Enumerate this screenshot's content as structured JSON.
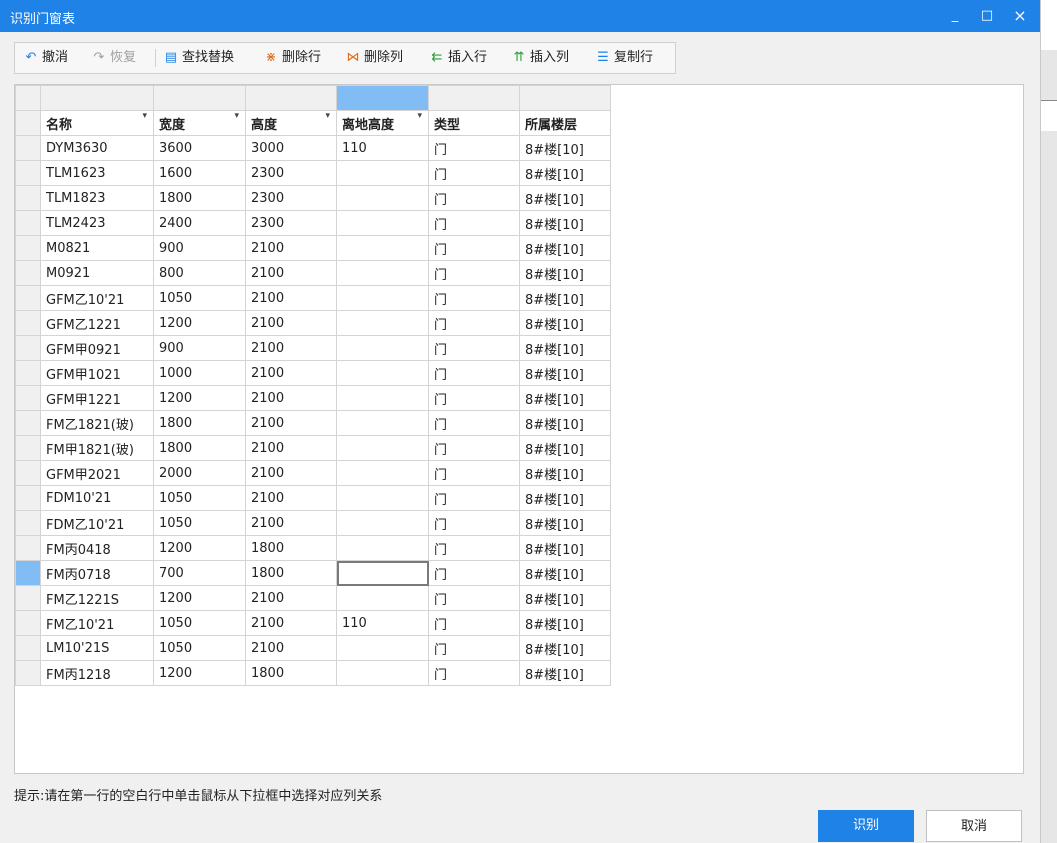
{
  "window": {
    "title": "识别门窗表",
    "minimize": "_",
    "maximize": "□",
    "close": "×"
  },
  "toolbar": {
    "undo": "撤消",
    "redo": "恢复",
    "find_replace": "查找替换",
    "delete_row": "删除行",
    "delete_col": "删除列",
    "insert_row": "插入行",
    "insert_col": "插入列",
    "copy_row": "复制行"
  },
  "grid": {
    "columns": [
      "名称",
      "宽度",
      "高度",
      "离地高度",
      "类型",
      "所属楼层"
    ],
    "dropdown_marker": "▾",
    "rows": [
      [
        "DYM3630",
        "3600",
        "3000",
        "110",
        "门",
        "8#楼[10]"
      ],
      [
        "TLM1623",
        "1600",
        "2300",
        "",
        "门",
        "8#楼[10]"
      ],
      [
        "TLM1823",
        "1800",
        "2300",
        "",
        "门",
        "8#楼[10]"
      ],
      [
        "TLM2423",
        "2400",
        "2300",
        "",
        "门",
        "8#楼[10]"
      ],
      [
        "M0821",
        "900",
        "2100",
        "",
        "门",
        "8#楼[10]"
      ],
      [
        "M0921",
        "800",
        "2100",
        "",
        "门",
        "8#楼[10]"
      ],
      [
        "GFM乙10'21",
        "1050",
        "2100",
        "",
        "门",
        "8#楼[10]"
      ],
      [
        "GFM乙1221",
        "1200",
        "2100",
        "",
        "门",
        "8#楼[10]"
      ],
      [
        "GFM甲0921",
        "900",
        "2100",
        "",
        "门",
        "8#楼[10]"
      ],
      [
        "GFM甲1021",
        "1000",
        "2100",
        "",
        "门",
        "8#楼[10]"
      ],
      [
        "GFM甲1221",
        "1200",
        "2100",
        "",
        "门",
        "8#楼[10]"
      ],
      [
        "FM乙1821(玻)",
        "1800",
        "2100",
        "",
        "门",
        "8#楼[10]"
      ],
      [
        "FM甲1821(玻)",
        "1800",
        "2100",
        "",
        "门",
        "8#楼[10]"
      ],
      [
        "GFM甲2021",
        "2000",
        "2100",
        "",
        "门",
        "8#楼[10]"
      ],
      [
        "FDM10'21",
        "1050",
        "2100",
        "",
        "门",
        "8#楼[10]"
      ],
      [
        "FDM乙10'21",
        "1050",
        "2100",
        "",
        "门",
        "8#楼[10]"
      ],
      [
        "FM丙0418",
        "1200",
        "1800",
        "",
        "门",
        "8#楼[10]"
      ],
      [
        "FM丙0718",
        "700",
        "1800",
        "",
        "门",
        "8#楼[10]"
      ],
      [
        "FM乙1221S",
        "1200",
        "2100",
        "",
        "门",
        "8#楼[10]"
      ],
      [
        "FM乙10'21",
        "1050",
        "2100",
        "110",
        "门",
        "8#楼[10]"
      ],
      [
        "LM10'21S",
        "1050",
        "2100",
        "",
        "门",
        "8#楼[10]"
      ],
      [
        "FM丙1218",
        "1200",
        "1800",
        "",
        "门",
        "8#楼[10]"
      ]
    ]
  },
  "hint": "提示:请在第一行的空白行中单击鼠标从下拉框中选择对应列关系",
  "buttons": {
    "recognize": "识别",
    "cancel": "取消"
  },
  "colors": {
    "accent": "#1e82e6",
    "selection": "#82bcf5"
  }
}
